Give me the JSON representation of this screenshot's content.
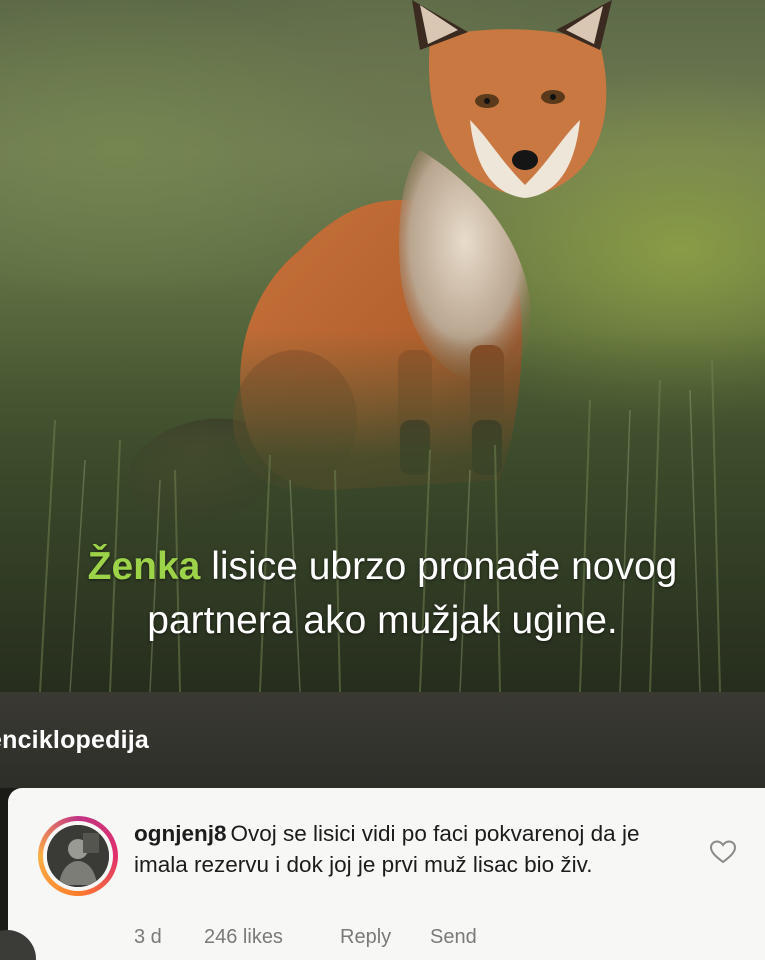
{
  "post": {
    "caption_highlight": "Ženka",
    "caption_line1_rest": " lisice ubrzo pronađe novog",
    "caption_line2": "partnera ako mužjak ugine.",
    "highlight_color": "#9cd349",
    "image_subject": "fox-photo"
  },
  "account": {
    "name": "enciklopedija"
  },
  "comment": {
    "username": "ognjenj8",
    "text": "Ovoj se lisici vidi po faci pokvarenoj da je imala rezervu i dok joj je prvi muž lisac bio živ.",
    "time": "3 d",
    "likes": "246 likes",
    "reply_label": "Reply",
    "send_label": "Send",
    "like_icon": "heart-outline-icon"
  }
}
